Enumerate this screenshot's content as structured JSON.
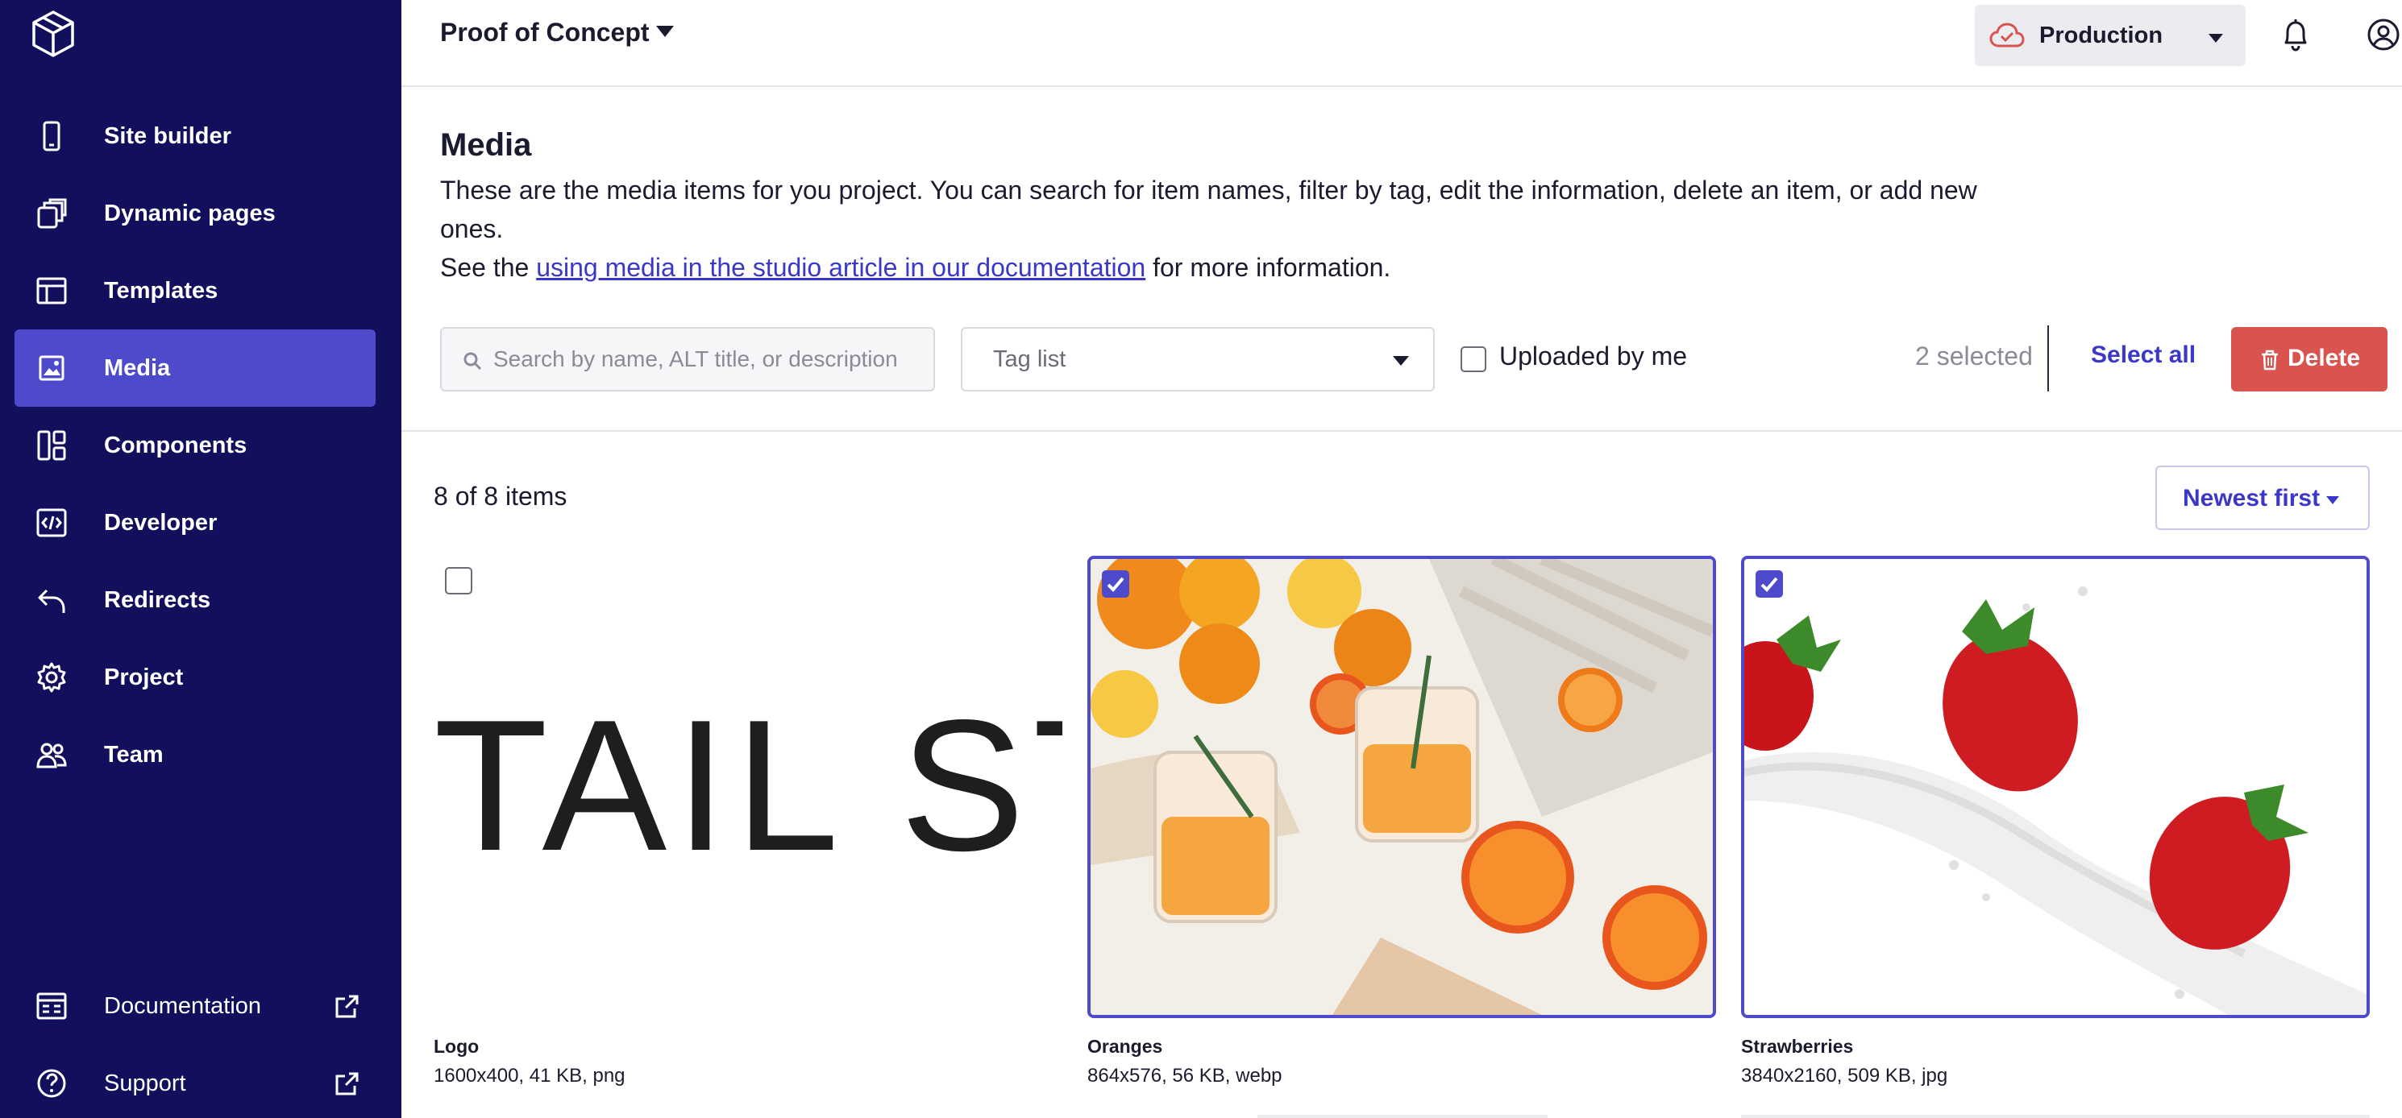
{
  "sidebar": {
    "items": [
      {
        "label": "Site builder",
        "icon": "phone-icon",
        "active": false
      },
      {
        "label": "Dynamic pages",
        "icon": "stacked-pages-icon",
        "active": false
      },
      {
        "label": "Templates",
        "icon": "template-icon",
        "active": false
      },
      {
        "label": "Media",
        "icon": "image-icon",
        "active": true
      },
      {
        "label": "Components",
        "icon": "components-icon",
        "active": false
      },
      {
        "label": "Developer",
        "icon": "code-icon",
        "active": false
      },
      {
        "label": "Redirects",
        "icon": "redirect-arrow-icon",
        "active": false
      },
      {
        "label": "Project",
        "icon": "gear-icon",
        "active": false
      },
      {
        "label": "Team",
        "icon": "team-icon",
        "active": false
      }
    ],
    "footer": [
      {
        "label": "Documentation",
        "icon": "documentation-icon"
      },
      {
        "label": "Support",
        "icon": "help-circle-icon"
      }
    ]
  },
  "header": {
    "project_name": "Proof of Concept",
    "environment": "Production",
    "environment_color": "#d9534f"
  },
  "main": {
    "title": "Media",
    "description_line1": "These are the media items for you project. You can search for item names, filter by tag, edit the information, delete an item, or add new ones.",
    "description_prefix": "See the ",
    "description_link": "using media in the studio article in our documentation",
    "description_suffix": " for more information.",
    "search_placeholder": "Search by name, ALT title, or description",
    "tag_placeholder": "Tag list",
    "uploaded_by_me": "Uploaded by me",
    "uploaded_checked": false,
    "selected_count": "2 selected",
    "select_all": "Select all",
    "delete": "Delete",
    "items_count": "8 of 8 items",
    "sort": "Newest first"
  },
  "media_items": [
    {
      "name": "Logo",
      "meta": "1600x400, 41 KB, png",
      "selected": false,
      "preview_text": "TAIL ST"
    },
    {
      "name": "Oranges",
      "meta": "864x576, 56 KB, webp",
      "selected": true
    },
    {
      "name": "Strawberries",
      "meta": "3840x2160, 509 KB, jpg",
      "selected": true
    }
  ],
  "colors": {
    "sidebar_bg": "#120f5c",
    "active_item": "#4d4acb",
    "accent": "#3b37c9",
    "danger": "#d9534f"
  }
}
